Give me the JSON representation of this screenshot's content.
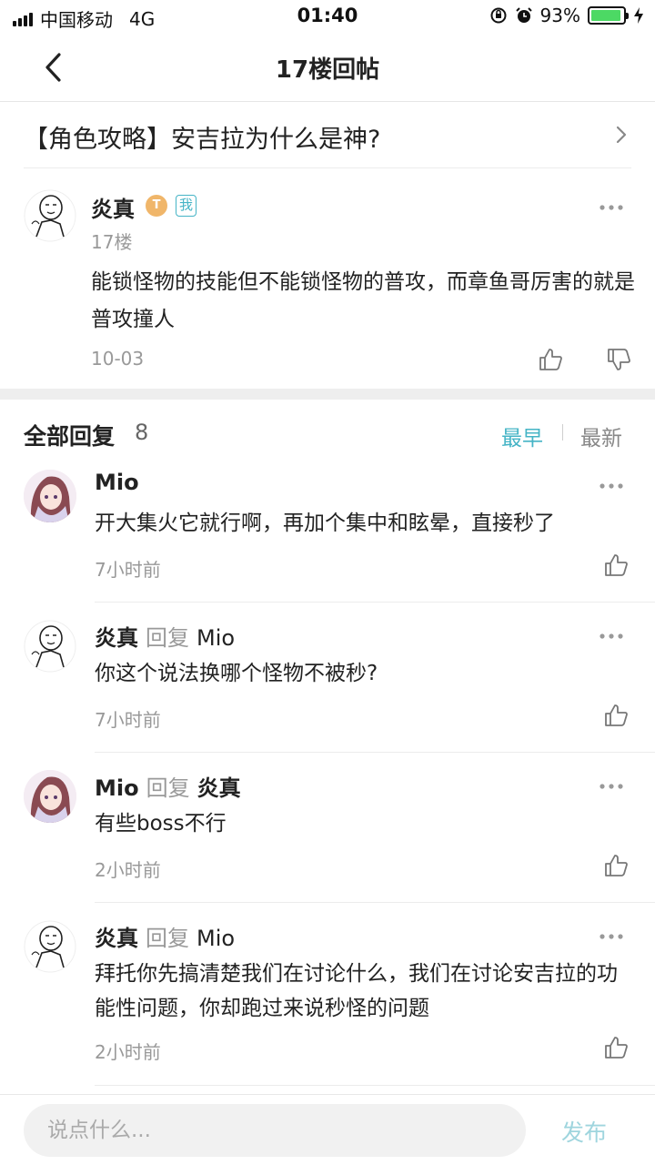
{
  "status_bar": {
    "carrier": "中国移动",
    "network": "4G",
    "time": "01:40",
    "battery": "93%",
    "battery_level": 0.93
  },
  "nav": {
    "title": "17楼回帖"
  },
  "thread": {
    "title": "【角色攻略】安吉拉为什么是神?"
  },
  "floor_post": {
    "author": "炎真",
    "level_badge": "T",
    "me_badge": "我",
    "floor": "17楼",
    "content": "能锁怪物的技能但不能锁怪物的普攻，而章鱼哥厉害的就是普攻撞人",
    "date": "10-03"
  },
  "replies_header": {
    "title": "全部回复",
    "count": "8",
    "sort_earliest": "最早",
    "sort_latest": "最新"
  },
  "replies": [
    {
      "author": "Mio",
      "verb": "",
      "target": "",
      "content": "开大集火它就行啊，再加个集中和眩晕，直接秒了",
      "time": "7小时前"
    },
    {
      "author": "炎真",
      "verb": "回复",
      "target": "Mio",
      "content": "你这个说法换哪个怪物不被秒?",
      "time": "7小时前"
    },
    {
      "author": "Mio",
      "verb": "回复",
      "target": "炎真",
      "content": "有些boss不行",
      "time": "2小时前"
    },
    {
      "author": "炎真",
      "verb": "回复",
      "target": "Mio",
      "content": "拜托你先搞清楚我们在讨论什么，我们在讨论安吉拉的功能性问题，你却跑过来说秒怪的问题",
      "time": "2小时前"
    }
  ],
  "bottom_bar": {
    "input_placeholder": "说点什么...",
    "publish_label": "发布"
  },
  "colors": {
    "accent": "#45b4c6",
    "publish_disabled": "#9fd5de",
    "battery_green": "#4cd964"
  }
}
